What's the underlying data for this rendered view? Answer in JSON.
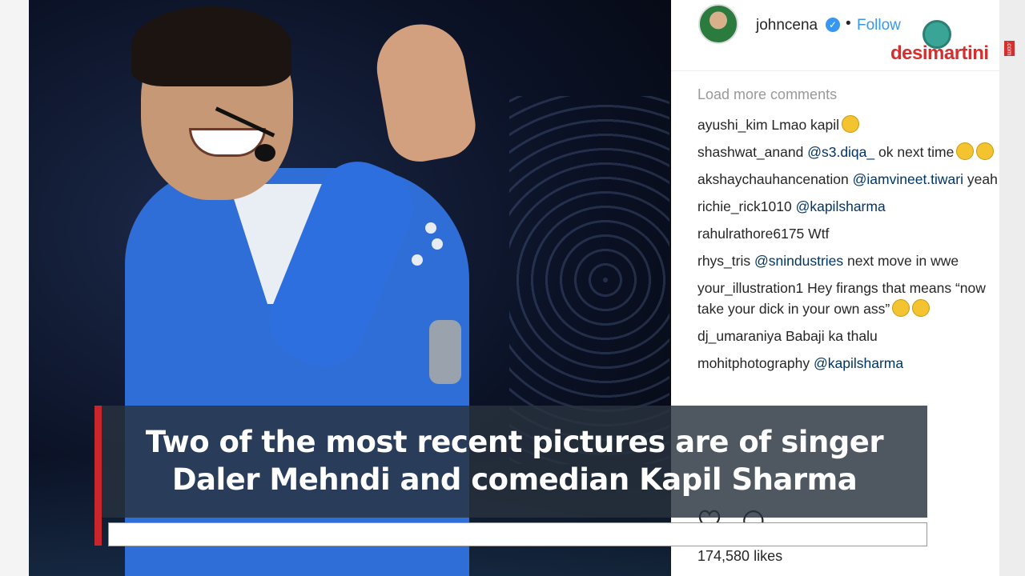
{
  "post": {
    "username": "johncena",
    "separator": "•",
    "follow_label": "Follow",
    "verified_mark": "✓",
    "load_more": "Load more comments",
    "comments": [
      {
        "user": "ayushi_kim",
        "text": "Lmao kapil",
        "emoji_count": 1
      },
      {
        "user": "shashwat_anand",
        "mention": "@s3.diqa_",
        "text": "ok next time",
        "emoji_count": 2
      },
      {
        "user": "akshaychauhancenation",
        "mention": "@iamvineet.tiwari",
        "text": "yeah bro",
        "emoji_count": 0
      },
      {
        "user": "richie_rick1010",
        "mention": "@kapilsharma",
        "text": "",
        "emoji_count": 0
      },
      {
        "user": "rahulrathore6175",
        "text": "Wtf",
        "emoji_count": 0
      },
      {
        "user": "rhys_tris",
        "mention": "@snindustries",
        "text": "next move in wwe",
        "emoji_count": 0
      },
      {
        "user": "your_illustration1",
        "text": "Hey firangs that means “now take your dick in your own ass”",
        "emoji_count": 2
      },
      {
        "user": "dj_umaraniya",
        "text": "Babaji ka thalu",
        "emoji_count": 0
      },
      {
        "user": "mohitphotography",
        "mention": "@kapilsharma",
        "text": "",
        "emoji_count": 0
      }
    ],
    "likes": "174,580 likes"
  },
  "logo": {
    "text": "desimartini",
    "suffix": ".com"
  },
  "caption": {
    "line1": "Two of the most recent pictures are of singer",
    "line2": "Daler Mehndi and comedian Kapil Sharma"
  },
  "colors": {
    "accent": "#3897f0",
    "caption_bar": "#c8262b",
    "logo": "#d42e2e"
  },
  "icons": [
    "verified-icon",
    "heart-icon",
    "comment-icon",
    "emoji-icon"
  ]
}
